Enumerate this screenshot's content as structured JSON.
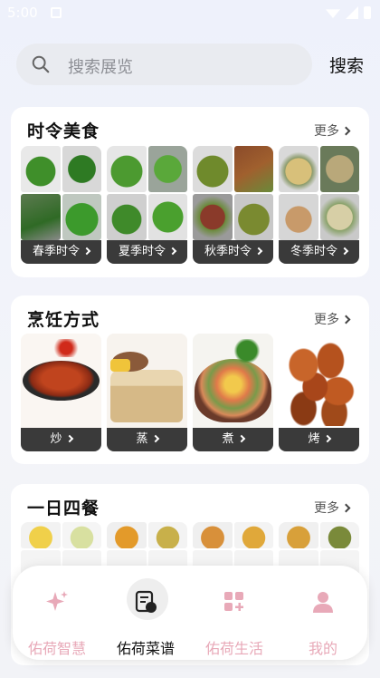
{
  "status_bar": {
    "time": "5:00"
  },
  "search": {
    "placeholder": "搜索展览",
    "button_label": "搜索"
  },
  "sections": {
    "seasonal": {
      "title": "时令美食",
      "more": "更多",
      "items": [
        {
          "label": "春季时令"
        },
        {
          "label": "夏季时令"
        },
        {
          "label": "秋季时令"
        },
        {
          "label": "冬季时令"
        }
      ]
    },
    "cooking": {
      "title": "烹饪方式",
      "more": "更多",
      "items": [
        {
          "label": "炒"
        },
        {
          "label": "蒸"
        },
        {
          "label": "煮"
        },
        {
          "label": "烤"
        }
      ]
    },
    "meals": {
      "title": "一日四餐",
      "more": "更多"
    }
  },
  "nav": {
    "items": [
      {
        "label": "佑荷智慧",
        "icon": "sparkle-icon"
      },
      {
        "label": "佑荷菜谱",
        "icon": "recipe-book-icon"
      },
      {
        "label": "佑荷生活",
        "icon": "apps-plus-icon"
      },
      {
        "label": "我的",
        "icon": "person-icon"
      }
    ]
  },
  "colors": {
    "accent_pink": "#e8a9b8",
    "label_dark": "#3a3a3a"
  }
}
